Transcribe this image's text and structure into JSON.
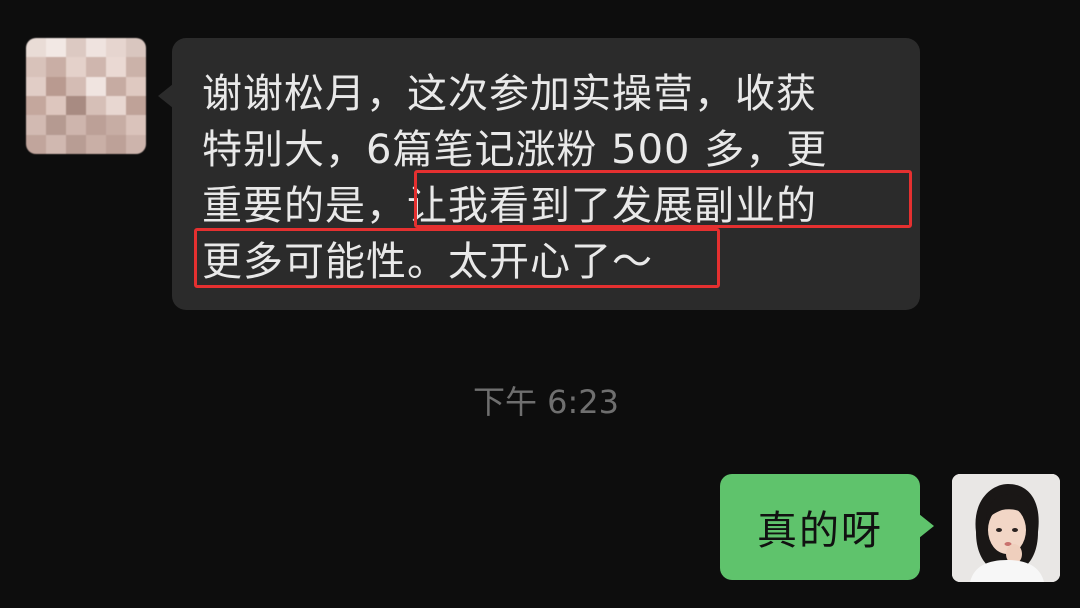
{
  "messages": {
    "incoming": {
      "line1": "谢谢松月，这次参加实操营，收获",
      "line2": "特别大，6篇笔记涨粉 500 多，更",
      "line3_plain": "重要的是，",
      "line3_highlight": "让我看到了发展副业的",
      "line4_highlight": "更多可能性。太开心了～",
      "avatar_icon": "blurred-avatar-icon",
      "highlight_color": "#e53030",
      "bubble_color": "#2b2b2b"
    },
    "timestamp": "下午 6:23",
    "outgoing": {
      "text": "真的呀",
      "avatar_icon": "girl-avatar-icon",
      "bubble_color": "#5fc36c"
    }
  }
}
